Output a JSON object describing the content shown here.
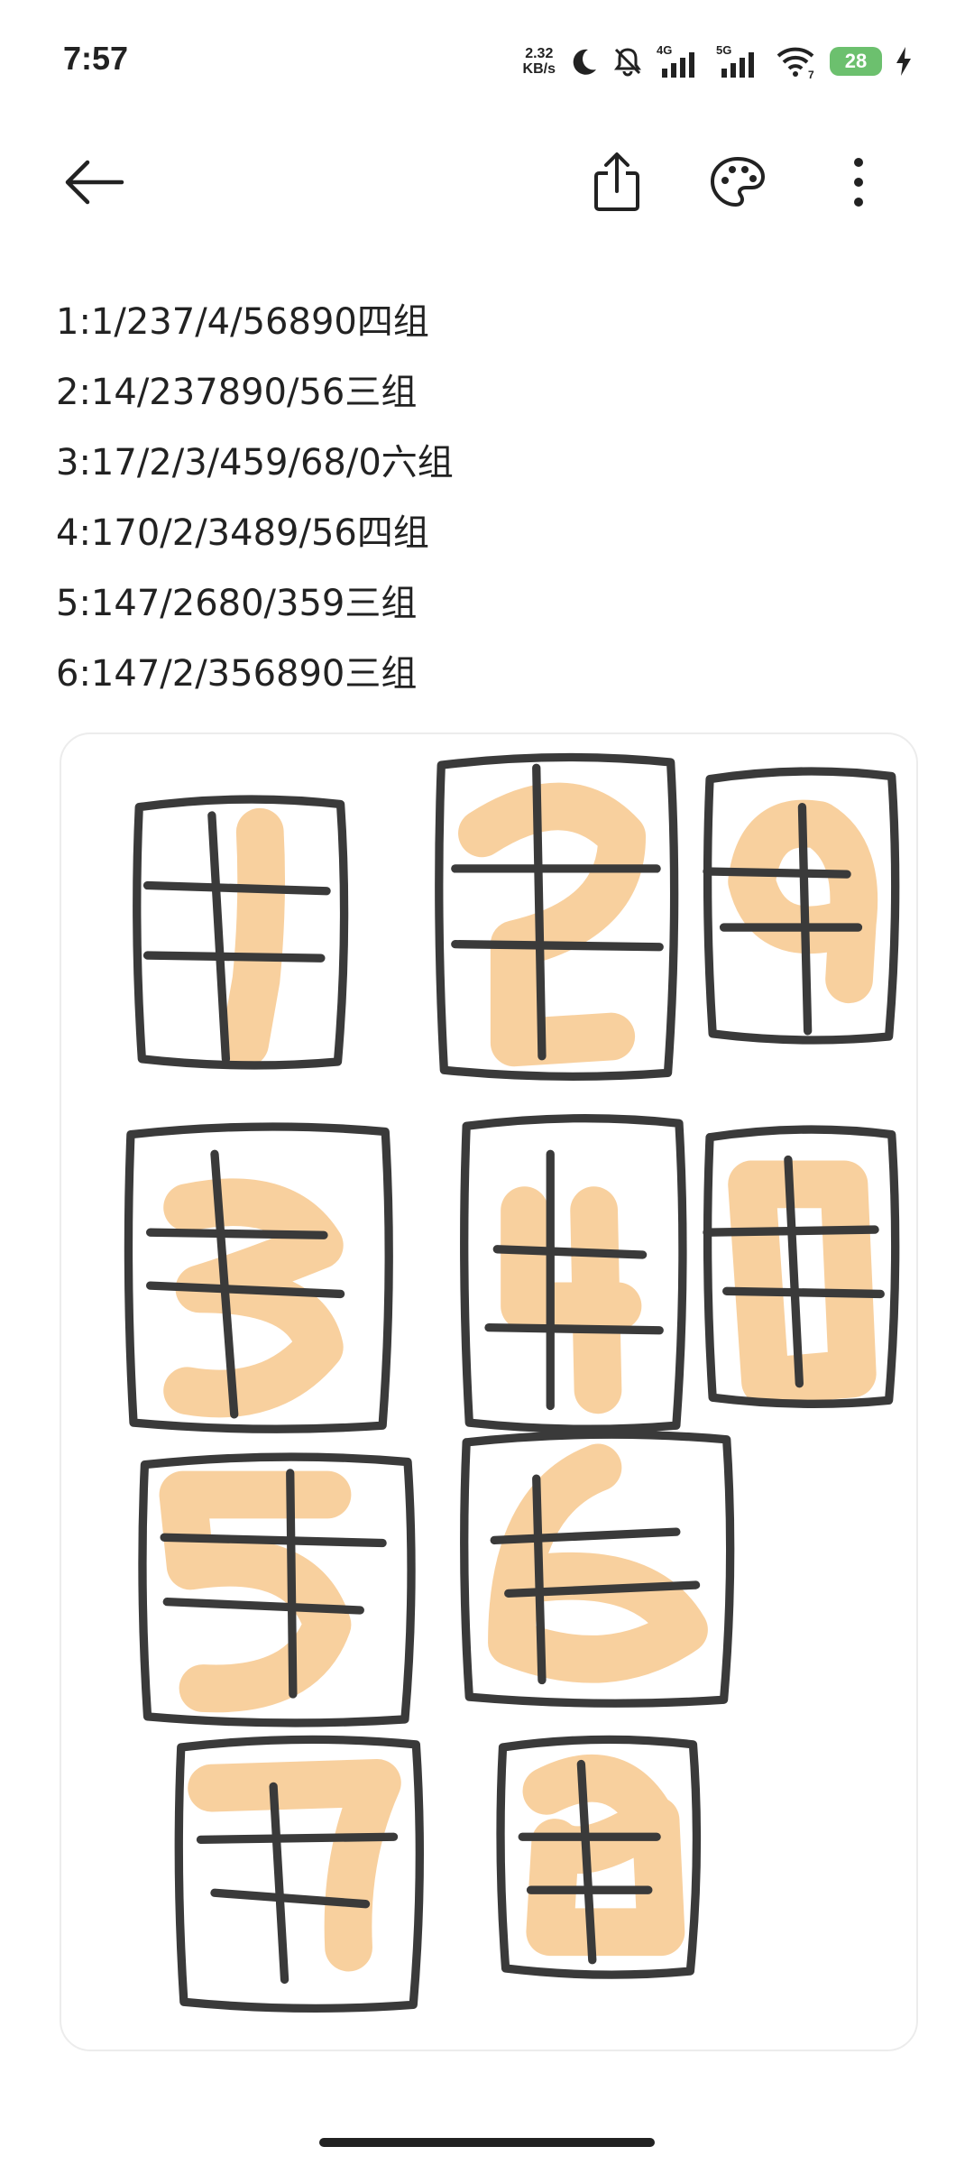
{
  "status_bar": {
    "time": "7:57",
    "net_speed_value": "2.32",
    "net_speed_unit": "KB/s",
    "sim1_label": "4G",
    "sim2_label": "5G",
    "wifi_badge": "7",
    "battery_level": "28",
    "charging": true,
    "icons": [
      "moon-icon",
      "silent-mode-icon",
      "signal-icon",
      "wifi-icon",
      "battery-icon",
      "charging-bolt-icon"
    ]
  },
  "toolbar": {
    "back_icon": "back-arrow-icon",
    "share_icon": "share-icon",
    "theme_icon": "palette-icon",
    "more_icon": "more-vertical-icon"
  },
  "note": {
    "lines": [
      "1:1/237/4/56890四组",
      "2:14/237890/56三组",
      "3:17/2/3/459/68/0六组",
      "4:170/2/3489/56四组",
      "5:147/2680/359三组",
      "6:147/2/356890三组"
    ]
  },
  "drawing": {
    "description_free": true,
    "digits": [
      "1",
      "2",
      "9",
      "3",
      "4",
      "0",
      "5",
      "6",
      "7",
      "8"
    ],
    "stroke_color": "#3a3a3a",
    "highlight_color": "#f6c07d"
  }
}
